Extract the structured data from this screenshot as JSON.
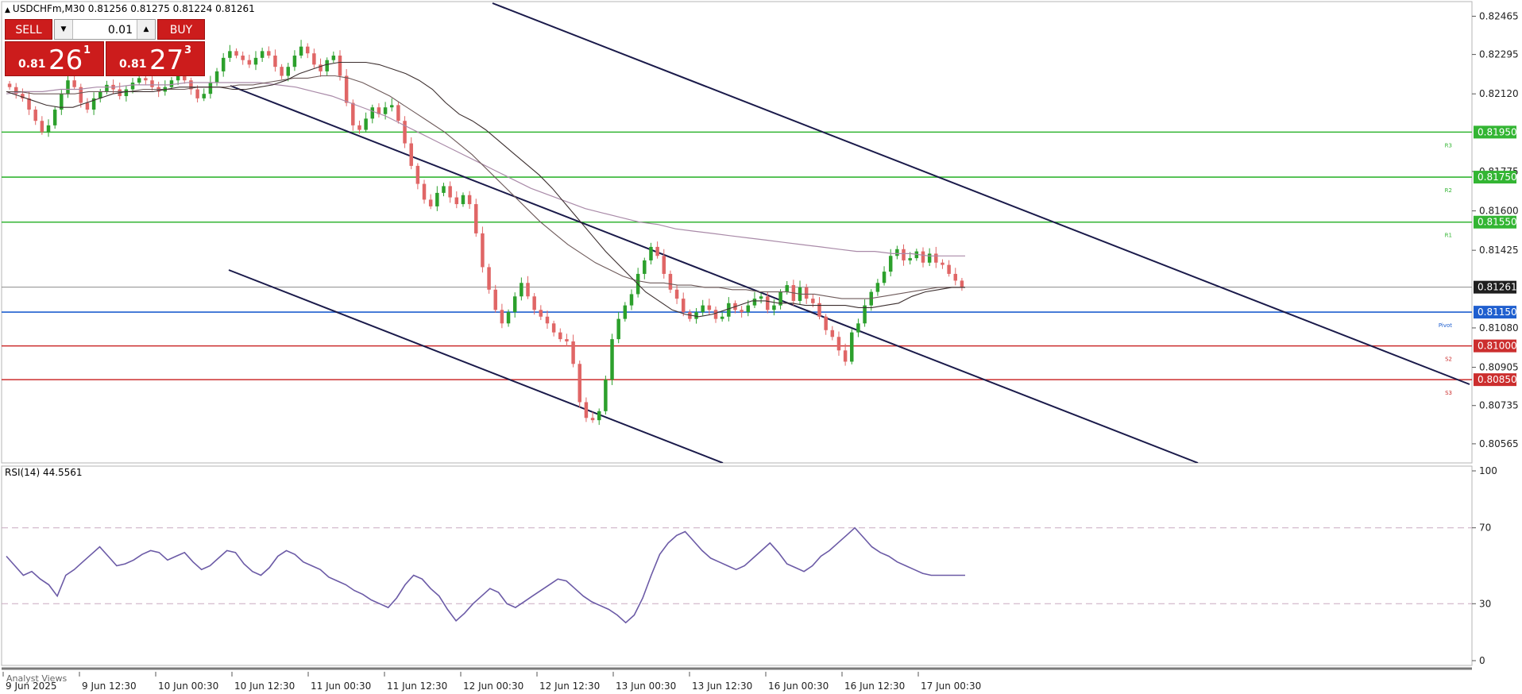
{
  "header": {
    "symbol_line": "USDCHFm,M30  0.81256 0.81275 0.81224 0.81261"
  },
  "trade_panel": {
    "sell_label": "SELL",
    "buy_label": "BUY",
    "lot": "0.01",
    "sell_small": "0.81",
    "sell_big": "26",
    "sell_sup": "1",
    "buy_small": "0.81",
    "buy_big": "27",
    "buy_sup": "3"
  },
  "rsi": {
    "label": "RSI(14) 44.5561",
    "levels": [
      "100",
      "70",
      "30",
      "0"
    ]
  },
  "footer": {
    "analyst_views": "Analyst Views"
  },
  "colors": {
    "bull": "#2ca02c",
    "bear": "#e06666",
    "resistance": "#33b533",
    "pivot": "#1f5fcf",
    "support": "#cc2e2e",
    "channel": "#1a1a4a",
    "rsi": "#6b5aa6",
    "current": "#1f1f1f"
  },
  "chart_data": [
    {
      "type": "candlestick",
      "title": "USDCHFm,M30",
      "ylim": [
        0.8048,
        0.8253
      ],
      "y_ticks": [
        "0.82465",
        "0.82295",
        "0.82120",
        "0.81775",
        "0.81600",
        "0.81425",
        "0.81080",
        "0.80905",
        "0.80735",
        "0.80565"
      ],
      "x_ticks": [
        "9 Jun 2025",
        "9 Jun 12:30",
        "10 Jun 00:30",
        "10 Jun 12:30",
        "11 Jun 00:30",
        "11 Jun 12:30",
        "12 Jun 00:30",
        "12 Jun 12:30",
        "13 Jun 00:30",
        "13 Jun 12:30",
        "16 Jun 00:30",
        "16 Jun 12:30",
        "17 Jun 00:30"
      ],
      "current_price": "0.81261",
      "levels": [
        {
          "label": "R3",
          "value": "0.81950",
          "kind": "resistance"
        },
        {
          "label": "R2",
          "value": "0.81750",
          "kind": "resistance"
        },
        {
          "label": "R1",
          "value": "0.81550",
          "kind": "resistance"
        },
        {
          "label": "Pivot",
          "value": "0.81150",
          "kind": "pivot"
        },
        {
          "label": "S2",
          "value": "0.81000",
          "kind": "support"
        },
        {
          "label": "S3",
          "value": "0.80850",
          "kind": "support"
        }
      ],
      "price_path": [
        0.8215,
        0.8212,
        0.821,
        0.8205,
        0.82,
        0.8195,
        0.8198,
        0.8205,
        0.8212,
        0.8218,
        0.8215,
        0.8208,
        0.8205,
        0.821,
        0.8213,
        0.8216,
        0.8214,
        0.8211,
        0.8214,
        0.8217,
        0.8219,
        0.8218,
        0.8215,
        0.8213,
        0.8215,
        0.8218,
        0.822,
        0.8218,
        0.8214,
        0.821,
        0.8212,
        0.8217,
        0.8222,
        0.8228,
        0.8231,
        0.8229,
        0.8227,
        0.8225,
        0.8228,
        0.8231,
        0.8229,
        0.8224,
        0.822,
        0.8224,
        0.8229,
        0.8233,
        0.823,
        0.8225,
        0.8222,
        0.8227,
        0.8229,
        0.822,
        0.8208,
        0.8198,
        0.8196,
        0.8201,
        0.8206,
        0.8203,
        0.8206,
        0.8207,
        0.82,
        0.819,
        0.818,
        0.8172,
        0.8165,
        0.8162,
        0.8168,
        0.8171,
        0.8166,
        0.8163,
        0.8167,
        0.8163,
        0.815,
        0.8135,
        0.8125,
        0.8116,
        0.811,
        0.8115,
        0.8122,
        0.8128,
        0.8122,
        0.8116,
        0.8113,
        0.811,
        0.8106,
        0.8103,
        0.8102,
        0.8092,
        0.8075,
        0.8068,
        0.8067,
        0.8071,
        0.8085,
        0.8103,
        0.8112,
        0.8118,
        0.8123,
        0.8132,
        0.8138,
        0.8144,
        0.814,
        0.8132,
        0.8125,
        0.8121,
        0.8115,
        0.8112,
        0.8115,
        0.8118,
        0.8116,
        0.8112,
        0.8113,
        0.8119,
        0.8116,
        0.8115,
        0.8118,
        0.8121,
        0.8122,
        0.8116,
        0.8118,
        0.8124,
        0.8127,
        0.812,
        0.8126,
        0.8121,
        0.8119,
        0.8113,
        0.8107,
        0.8104,
        0.8098,
        0.8093,
        0.8106,
        0.811,
        0.8118,
        0.8124,
        0.8128,
        0.8133,
        0.814,
        0.8143,
        0.8138,
        0.8139,
        0.8142,
        0.8137,
        0.8141,
        0.8137,
        0.8136,
        0.8132,
        0.8129,
        0.8126
      ],
      "ma_fast": [
        0.8213,
        0.8211,
        0.8209,
        0.8207,
        0.8206,
        0.8206,
        0.8208,
        0.821,
        0.8212,
        0.8213,
        0.8213,
        0.8213,
        0.8214,
        0.8215,
        0.8215,
        0.8215,
        0.8215,
        0.8214,
        0.8214,
        0.8215,
        0.8216,
        0.8218,
        0.8221,
        0.8223,
        0.8225,
        0.8226,
        0.8226,
        0.8226,
        0.8225,
        0.8223,
        0.8221,
        0.8218,
        0.8214,
        0.8208,
        0.8203,
        0.82,
        0.8196,
        0.8191,
        0.8186,
        0.8181,
        0.8176,
        0.817,
        0.8163,
        0.8156,
        0.8149,
        0.8142,
        0.8136,
        0.813,
        0.8124,
        0.812,
        0.8116,
        0.8114,
        0.8113,
        0.8114,
        0.8116,
        0.8118,
        0.812,
        0.812,
        0.8119,
        0.8119,
        0.8118,
        0.8118,
        0.8118,
        0.8118,
        0.8117,
        0.8117,
        0.8118,
        0.8119,
        0.8122,
        0.8124,
        0.8125,
        0.8126,
        0.8126
      ],
      "ma_mid": [
        0.8213,
        0.8213,
        0.8212,
        0.8212,
        0.8212,
        0.8212,
        0.8213,
        0.8213,
        0.8213,
        0.8213,
        0.8214,
        0.8214,
        0.8214,
        0.8214,
        0.8215,
        0.8215,
        0.8215,
        0.8216,
        0.8216,
        0.8217,
        0.8218,
        0.8219,
        0.8219,
        0.822,
        0.822,
        0.8219,
        0.8217,
        0.8214,
        0.8211,
        0.8207,
        0.8203,
        0.8199,
        0.8195,
        0.819,
        0.8185,
        0.8179,
        0.8173,
        0.8167,
        0.8161,
        0.8155,
        0.815,
        0.8145,
        0.8141,
        0.8137,
        0.8134,
        0.8131,
        0.8129,
        0.8128,
        0.8128,
        0.8127,
        0.8127,
        0.8126,
        0.8126,
        0.8125,
        0.8125,
        0.8124,
        0.8124,
        0.8124,
        0.8123,
        0.8123,
        0.8122,
        0.8121,
        0.8121,
        0.8121,
        0.8122,
        0.8123,
        0.8124,
        0.8125,
        0.8126,
        0.8126,
        0.8126
      ],
      "ma_slow": [
        0.8212,
        0.8213,
        0.8213,
        0.8214,
        0.8214,
        0.8215,
        0.8215,
        0.8216,
        0.8216,
        0.8216,
        0.8217,
        0.8217,
        0.8217,
        0.8217,
        0.8217,
        0.8216,
        0.8215,
        0.8213,
        0.8211,
        0.8208,
        0.8205,
        0.8202,
        0.8198,
        0.8194,
        0.819,
        0.8186,
        0.8182,
        0.8178,
        0.8174,
        0.817,
        0.8167,
        0.8164,
        0.8161,
        0.8159,
        0.8157,
        0.8155,
        0.8154,
        0.8152,
        0.8151,
        0.815,
        0.8149,
        0.8148,
        0.8147,
        0.8146,
        0.8145,
        0.8144,
        0.8143,
        0.8142,
        0.8142,
        0.8141,
        0.8141,
        0.814,
        0.814,
        0.814
      ]
    },
    {
      "type": "line",
      "title": "RSI(14) 44.5561",
      "ylim": [
        0,
        100
      ],
      "y_ticks": [
        "100",
        "70",
        "30",
        "0"
      ],
      "dashed_levels": [
        70,
        30
      ],
      "series": [
        {
          "name": "RSI(14)",
          "values": [
            55,
            50,
            45,
            47,
            43,
            40,
            34,
            45,
            48,
            52,
            56,
            60,
            55,
            50,
            51,
            53,
            56,
            58,
            57,
            53,
            55,
            57,
            52,
            48,
            50,
            54,
            58,
            57,
            51,
            47,
            45,
            49,
            55,
            58,
            56,
            52,
            50,
            48,
            44,
            42,
            40,
            37,
            35,
            32,
            30,
            28,
            33,
            40,
            45,
            43,
            38,
            34,
            27,
            21,
            25,
            30,
            34,
            38,
            36,
            30,
            28,
            31,
            34,
            37,
            40,
            43,
            42,
            38,
            34,
            31,
            29,
            27,
            24,
            20,
            24,
            33,
            45,
            56,
            62,
            66,
            68,
            63,
            58,
            54,
            52,
            50,
            48,
            50,
            54,
            58,
            62,
            57,
            51,
            49,
            47,
            50,
            55,
            58,
            62,
            66,
            70,
            65,
            60,
            57,
            55,
            52,
            50,
            48,
            46,
            45,
            45,
            45,
            45,
            45
          ]
        }
      ]
    }
  ]
}
